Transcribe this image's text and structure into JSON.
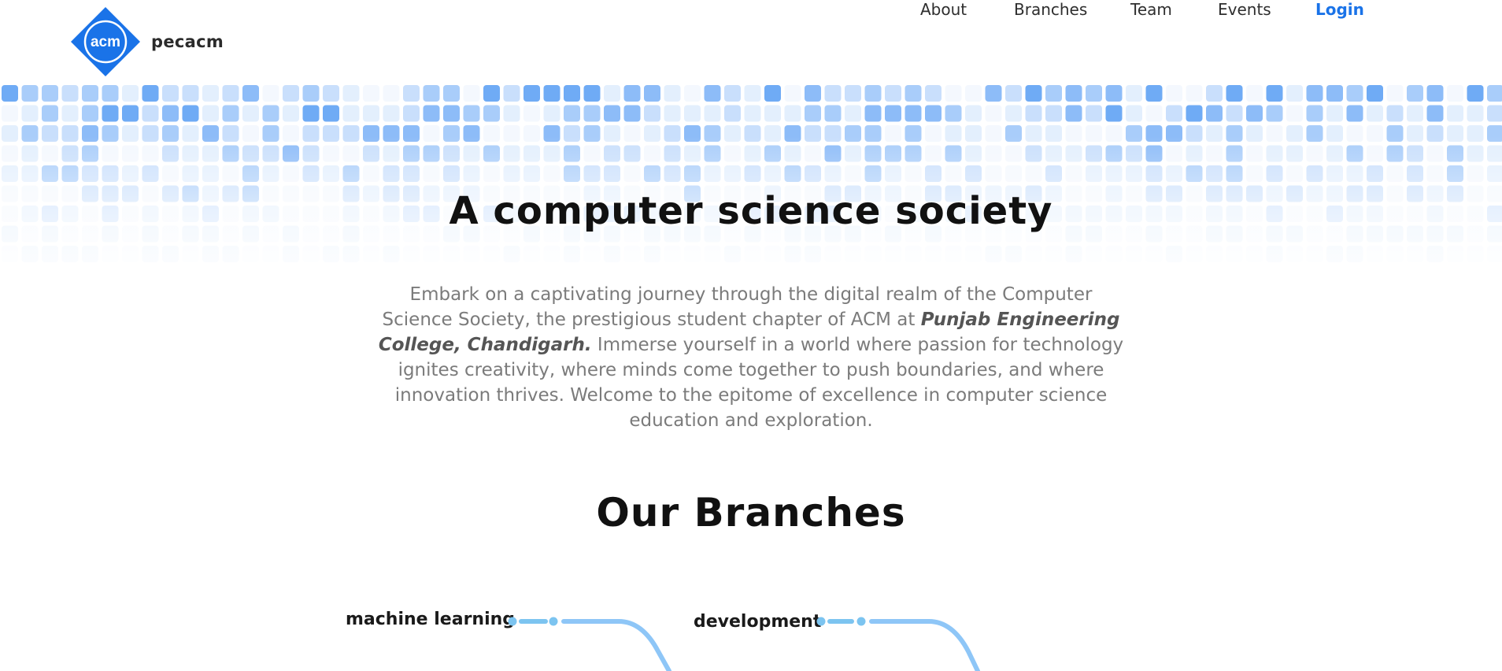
{
  "brand": {
    "logo_text": "acm",
    "name": "pecacm",
    "accent": "#1a73e8"
  },
  "nav": {
    "items": [
      {
        "label": "About"
      },
      {
        "label": "Branches"
      },
      {
        "label": "Team"
      },
      {
        "label": "Events"
      }
    ],
    "login_label": "Login"
  },
  "hero": {
    "title": "A computer science society",
    "grid_colors": [
      "#f4f8fe",
      "#e3effd",
      "#c9dffc",
      "#a9cdfa",
      "#8dbcf8",
      "#6fabf5"
    ]
  },
  "intro": {
    "before": "Embark on a captivating journey through the digital realm of the Computer Science Society, the prestigious student chapter of ACM at ",
    "highlight": "Punjab Engineering College, Chandigarh.",
    "after": " Immerse yourself in a world where passion for technology ignites creativity, where minds come together to push boundaries, and where innovation thrives. Welcome to the epitome of excellence in computer science education and exploration."
  },
  "branches": {
    "title": "Our Branches",
    "items": [
      {
        "label": "machine learning"
      },
      {
        "label": "development"
      }
    ]
  }
}
